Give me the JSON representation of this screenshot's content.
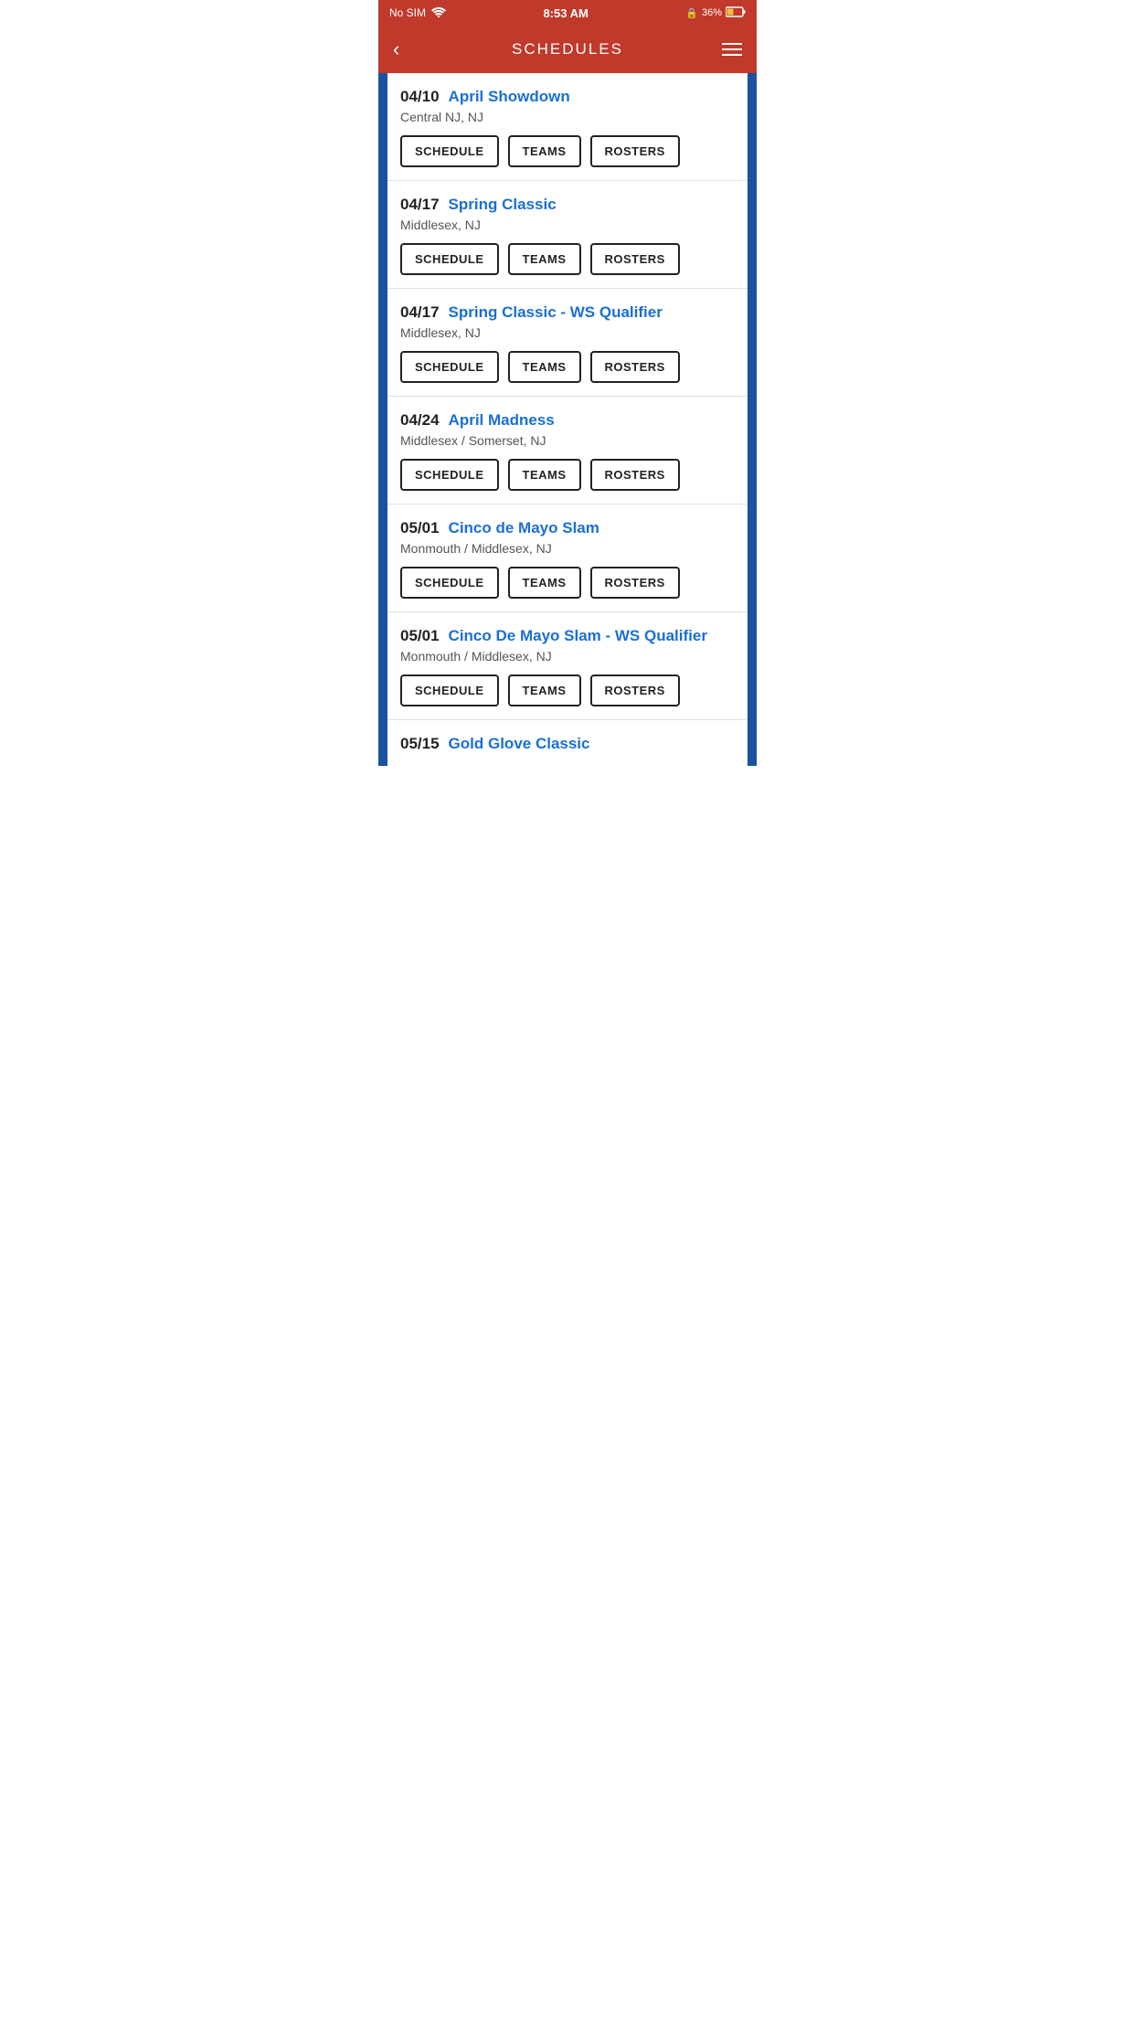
{
  "statusBar": {
    "carrier": "No SIM",
    "time": "8:53 AM",
    "lock": "🔒",
    "battery": "36%"
  },
  "nav": {
    "back": "‹",
    "title": "SCHEDULES",
    "menu": "☰"
  },
  "buttons": {
    "schedule": "SCHEDULE",
    "teams": "TEAMS",
    "rosters": "ROSTERS"
  },
  "events": [
    {
      "date": "04/10",
      "name": "April Showdown",
      "location": "Central NJ, NJ"
    },
    {
      "date": "04/17",
      "name": "Spring Classic",
      "location": "Middlesex, NJ"
    },
    {
      "date": "04/17",
      "name": "Spring Classic - WS Qualifier",
      "location": "Middlesex, NJ"
    },
    {
      "date": "04/24",
      "name": "April Madness",
      "location": "Middlesex / Somerset, NJ"
    },
    {
      "date": "05/01",
      "name": "Cinco de Mayo Slam",
      "location": "Monmouth / Middlesex, NJ"
    },
    {
      "date": "05/01",
      "name": "Cinco De Mayo Slam - WS Qualifier",
      "location": "Monmouth / Middlesex, NJ"
    },
    {
      "date": "05/15",
      "name": "Gold Glove Classic",
      "location": ""
    }
  ],
  "colors": {
    "accent": "#c0392b",
    "blue": "#1a52a0",
    "linkBlue": "#1a6fd4"
  }
}
